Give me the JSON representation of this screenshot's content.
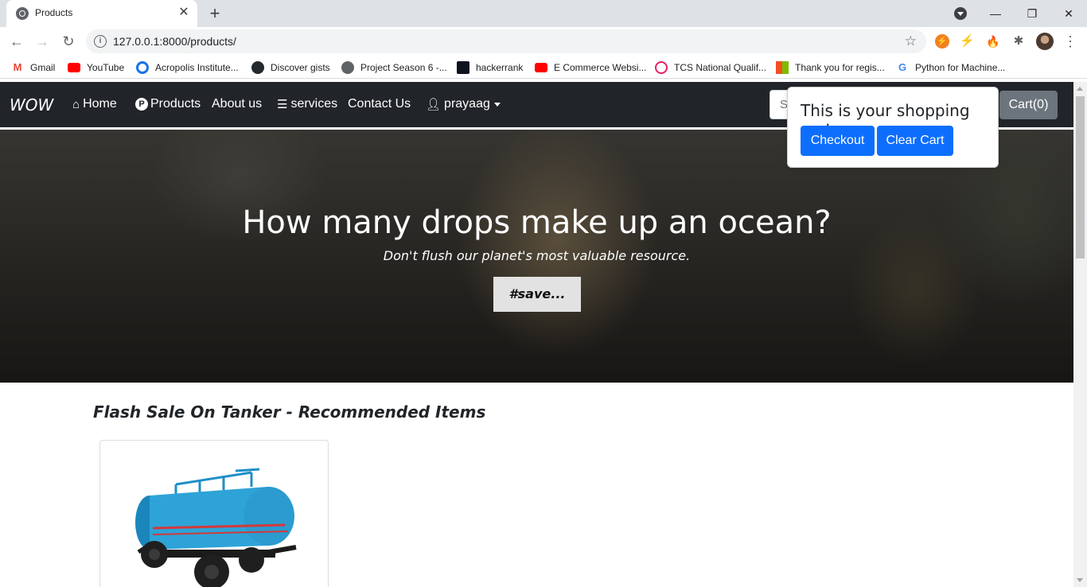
{
  "browser": {
    "tab_title": "Products",
    "url": "127.0.0.1:8000/products/",
    "bookmarks": [
      {
        "label": "Gmail",
        "icon": "gmail-icon",
        "color": "#ea4335"
      },
      {
        "label": "YouTube",
        "icon": "youtube-icon",
        "color": "#ff0000"
      },
      {
        "label": "Acropolis Institute...",
        "icon": "acropolis-icon",
        "color": "#1a73e8"
      },
      {
        "label": "Discover gists",
        "icon": "github-icon",
        "color": "#24292e"
      },
      {
        "label": "Project Season 6 -...",
        "icon": "globe-icon",
        "color": "#5f6368"
      },
      {
        "label": "hackerrank",
        "icon": "hackerrank-icon",
        "color": "#0e141e"
      },
      {
        "label": "E Commerce Websi...",
        "icon": "youtube-icon",
        "color": "#ff0000"
      },
      {
        "label": "TCS National Qualif...",
        "icon": "tcs-icon",
        "color": "#e91e63"
      },
      {
        "label": "Thank you for regis...",
        "icon": "microsoft-icon",
        "color": "#f25022"
      },
      {
        "label": "Python for Machine...",
        "icon": "google-icon",
        "color": "#4285f4"
      }
    ]
  },
  "site": {
    "brand": "WOW",
    "nav": {
      "home": "Home",
      "products": "Products",
      "about": "About us",
      "services": "services",
      "contact": "Contact Us",
      "user": "prayaag"
    },
    "search_placeholder": "Search",
    "cart_label": "Cart(0)",
    "popover": {
      "title": "This is your shopping cart",
      "checkout": "Checkout",
      "clear": "Clear Cart"
    },
    "hero": {
      "title": "How many drops make up an ocean?",
      "subtitle": "Don't flush our planet's most valuable resource.",
      "button": "#save..."
    },
    "section_title": "Flash Sale On Tanker - Recommended Items"
  },
  "colors": {
    "navbar": "#212529",
    "primary": "#0d6efd",
    "cart_button": "#6c757d",
    "tanker_body": "#2ea3d8"
  }
}
